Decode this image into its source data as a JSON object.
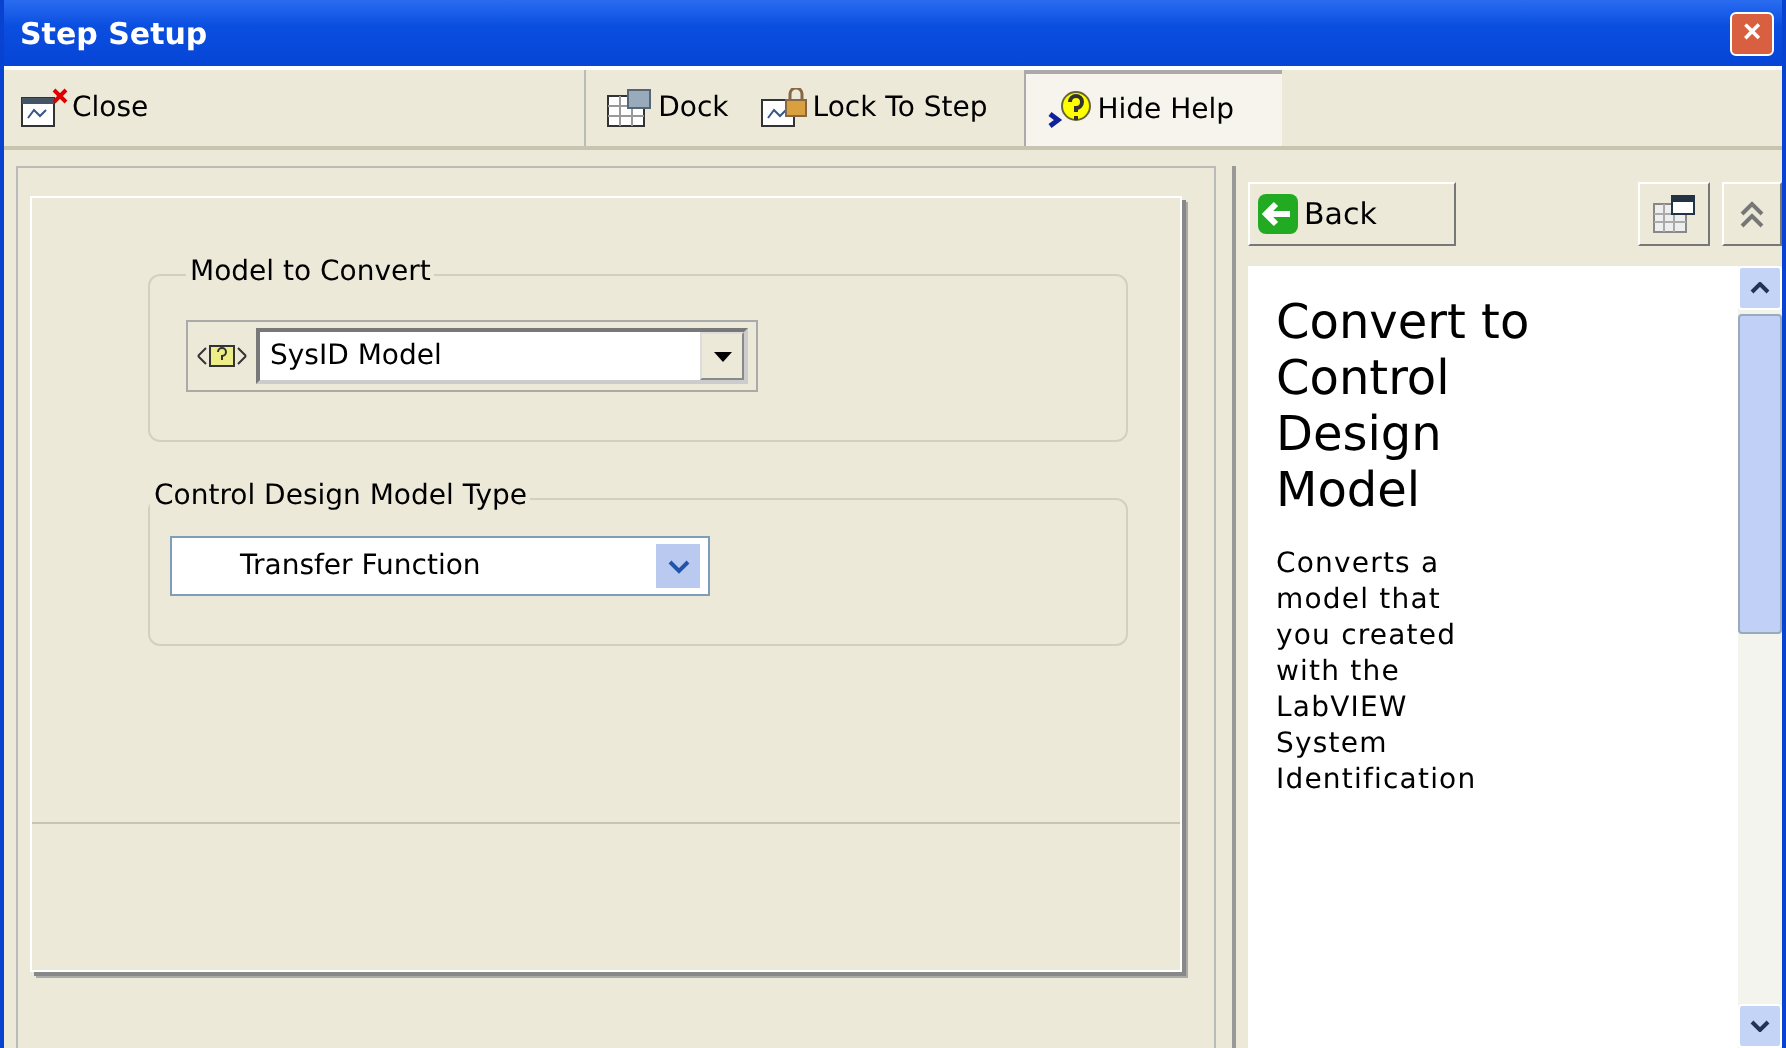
{
  "window": {
    "title": "Step Setup",
    "close": "×"
  },
  "toolbar": {
    "items": [
      {
        "kind": "close",
        "label": "Close",
        "selected": false
      },
      {
        "kind": "dock",
        "label": "Dock",
        "selected": false
      },
      {
        "kind": "lock",
        "label": "Lock To Step",
        "selected": false
      },
      {
        "kind": "help",
        "label": "Hide Help",
        "selected": true
      }
    ]
  },
  "groups": [
    {
      "label": "Model to Convert",
      "kind": "ring",
      "value": "SysID Model"
    },
    {
      "label": "Control Design Model Type",
      "kind": "combo",
      "value": "Transfer Function"
    }
  ],
  "help": {
    "back": "Back",
    "heading": "Convert to Control Design Model",
    "body": "Converts a model that you created with the LabVIEW System Identification"
  }
}
